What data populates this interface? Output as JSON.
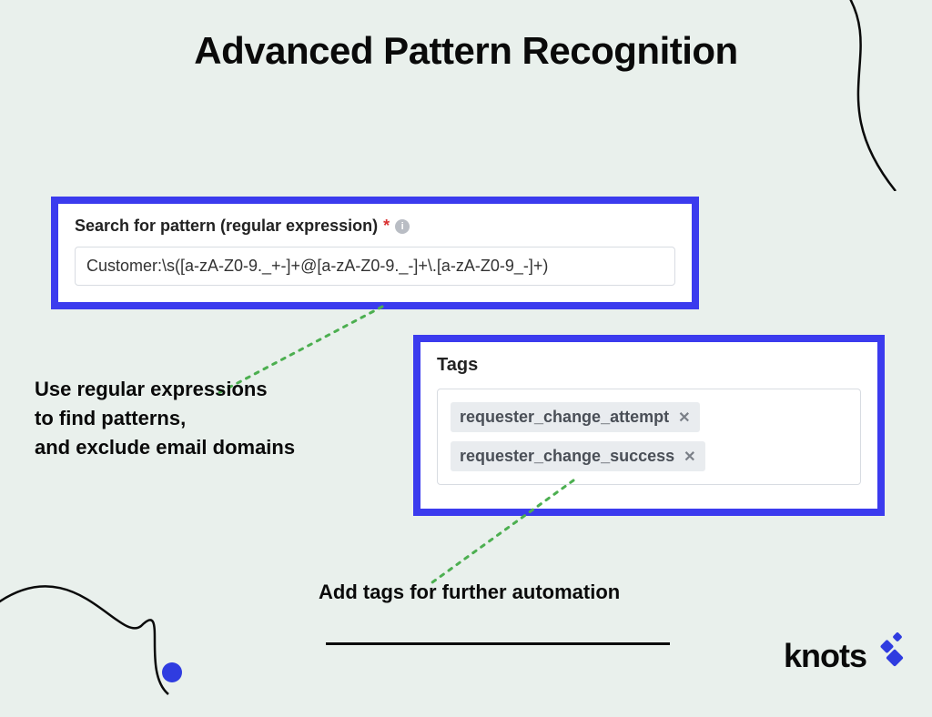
{
  "title": "Advanced Pattern Recognition",
  "search_panel": {
    "label": "Search for pattern (regular expression)",
    "required_mark": "*",
    "value": "Customer:\\s([a-zA-Z0-9._+-]+@[a-zA-Z0-9._-]+\\.[a-zA-Z0-9_-]+)"
  },
  "desc_left": "Use regular expressions\nto find patterns,\nand exclude email domains",
  "tags_panel": {
    "label": "Tags",
    "tags": [
      "requester_change_attempt",
      "requester_change_success"
    ]
  },
  "desc_bottom": "Add tags for further automation",
  "logo_text": "knots"
}
